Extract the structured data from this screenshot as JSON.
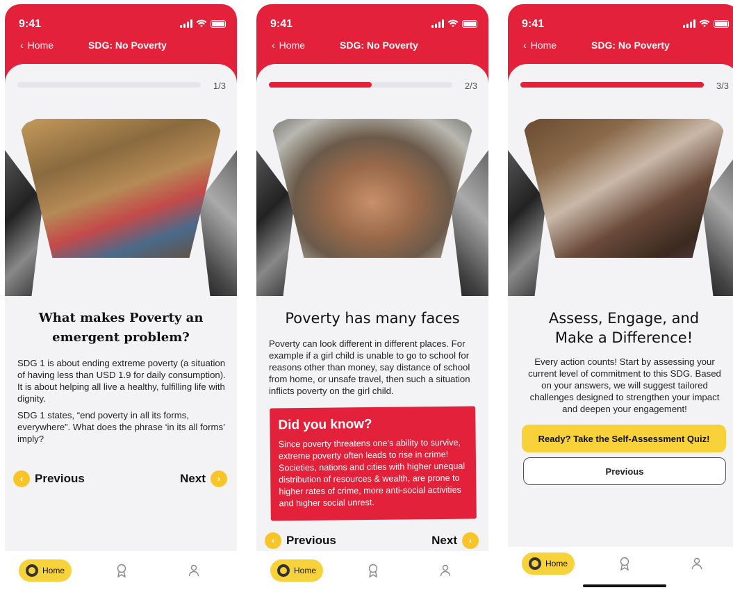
{
  "status": {
    "time": "9:41"
  },
  "header": {
    "back_label": "Home",
    "title": "SDG: No Poverty"
  },
  "screens": [
    {
      "progress": {
        "label": "1/3",
        "fraction": 0.0
      },
      "title_line1": "What makes Poverty an",
      "title_line2": "emergent problem?",
      "paragraphs": [
        "SDG 1 is about ending extreme poverty (a situation of having less than USD 1.9 for daily consumption). It is about helping all live a healthy, fulfilling life with dignity.",
        "SDG 1 states, “end poverty in all its forms, everywhere”. What does the phrase ‘in its all forms’ imply?"
      ],
      "previous_label": "Previous",
      "next_label": "Next"
    },
    {
      "progress": {
        "label": "2/3",
        "fraction": 0.5
      },
      "title": "Poverty has many faces",
      "paragraphs": [
        "Poverty can look different in different places. For example if a girl child is unable to go to school for reasons other than money, say distance of school from home, or unsafe travel, then such a situation inflicts poverty on the girl child."
      ],
      "callout": {
        "heading": "Did you know?",
        "text": "Since poverty threatens one’s ability to survive, extreme poverty often leads to rise in crime! Societies, nations and cities with higher unequal distribution of resources & wealth, are prone to higher rates of crime, more anti-social activities and higher social unrest."
      },
      "previous_label": "Previous",
      "next_label": "Next"
    },
    {
      "progress": {
        "label": "3/3",
        "fraction": 1.0
      },
      "title_line1": "Assess, Engage, and",
      "title_line2": "Make a Difference!",
      "paragraphs": [
        "Every action counts! Start by assessing your current level of commitment to this SDG. Based on your answers, we will suggest tailored challenges designed to strengthen your impact and deepen your engagement!"
      ],
      "primary_button": "Ready? Take the Self-Assessment Quiz!",
      "secondary_button": "Previous"
    }
  ],
  "tabbar": {
    "home_label": "Home"
  },
  "colors": {
    "brand_red": "#e3213a",
    "accent_yellow": "#f7d23a"
  },
  "icons": [
    "chevron-left-icon",
    "signal-icon",
    "wifi-icon",
    "battery-icon",
    "award-icon",
    "profile-icon",
    "home-icon"
  ]
}
